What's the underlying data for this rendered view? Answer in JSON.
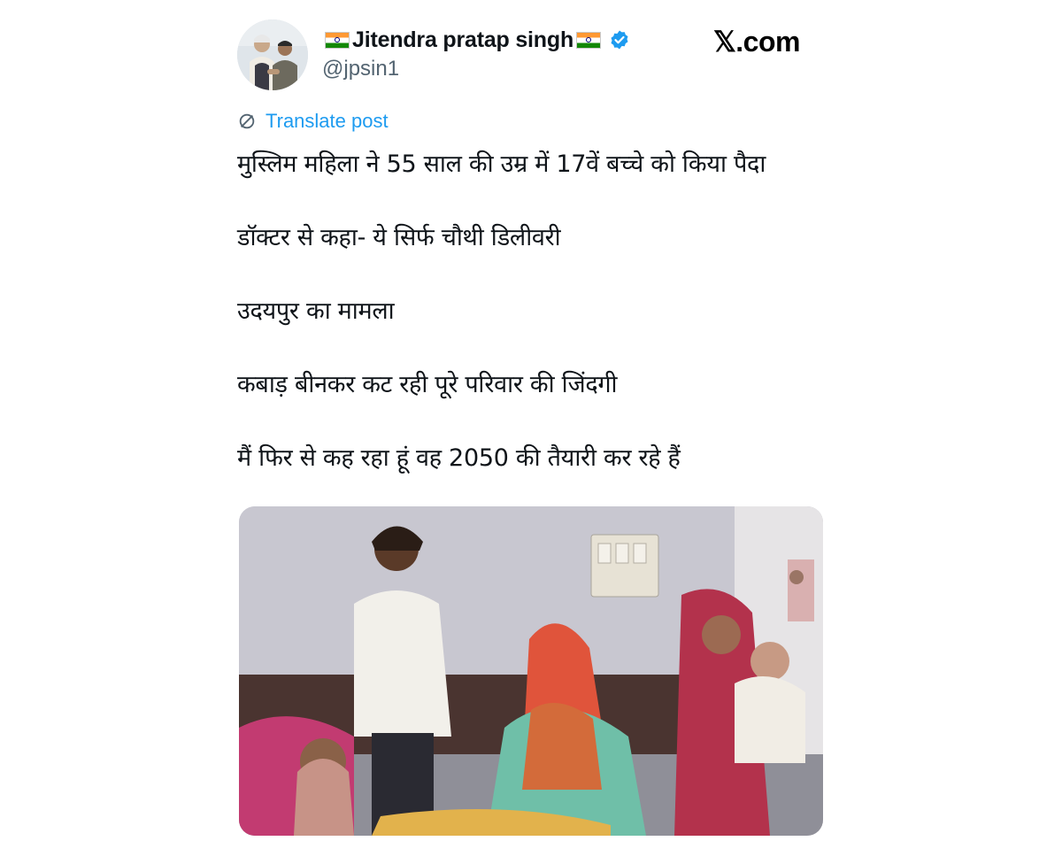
{
  "post": {
    "author_name": "Jitendra pratap singh",
    "author_handle": "@jpsin1",
    "brand": "𝕏.com",
    "translate_label": "Translate post",
    "lines": [
      "मुस्लिम महिला ने 55 साल की उम्र में 17वें बच्चे को किया पैदा",
      "डॉक्टर से कहा- ये सिर्फ चौथी डिलीवरी",
      "उदयपुर का मामला",
      "कबाड़ बीनकर कट रही पूरे परिवार की जिंदगी",
      "मैं फिर से कह रहा हूं वह 2050 की तैयारी कर रहे हैं"
    ],
    "icons": [
      "india-flag-icon",
      "verified-badge-icon",
      "translate-globe-icon"
    ],
    "colors": {
      "link": "#1d9bf0",
      "verified": "#1d9bf0",
      "handle": "#536471",
      "text": "#0f1419"
    }
  }
}
